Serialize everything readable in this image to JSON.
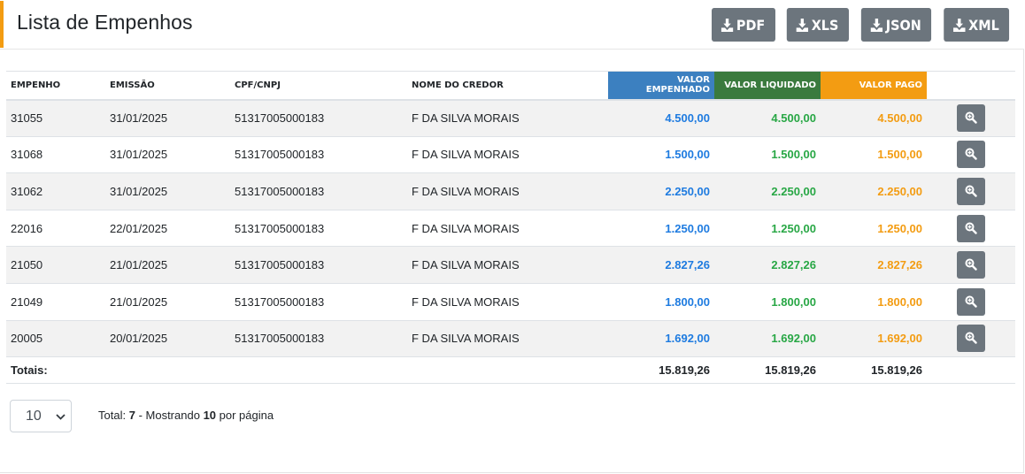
{
  "header": {
    "title": "Lista de Empenhos",
    "buttons": [
      "PDF",
      "XLS",
      "JSON",
      "XML"
    ]
  },
  "table": {
    "columns": {
      "empenho": "EMPENHO",
      "emissao": "EMISSÃO",
      "cpf": "CPF/CNPJ",
      "credor": "NOME DO CREDOR",
      "valor_empenhado": "VALOR EMPENHADO",
      "valor_liquidado": "VALOR LIQUIDADO",
      "valor_pago": "VALOR PAGO"
    },
    "rows": [
      {
        "empenho": "31055",
        "emissao": "31/01/2025",
        "cpf": "51317005000183",
        "credor": "F DA SILVA MORAIS",
        "empenhado": "4.500,00",
        "liquidado": "4.500,00",
        "pago": "4.500,00"
      },
      {
        "empenho": "31068",
        "emissao": "31/01/2025",
        "cpf": "51317005000183",
        "credor": "F DA SILVA MORAIS",
        "empenhado": "1.500,00",
        "liquidado": "1.500,00",
        "pago": "1.500,00"
      },
      {
        "empenho": "31062",
        "emissao": "31/01/2025",
        "cpf": "51317005000183",
        "credor": "F DA SILVA MORAIS",
        "empenhado": "2.250,00",
        "liquidado": "2.250,00",
        "pago": "2.250,00"
      },
      {
        "empenho": "22016",
        "emissao": "22/01/2025",
        "cpf": "51317005000183",
        "credor": "F DA SILVA MORAIS",
        "empenhado": "1.250,00",
        "liquidado": "1.250,00",
        "pago": "1.250,00"
      },
      {
        "empenho": "21050",
        "emissao": "21/01/2025",
        "cpf": "51317005000183",
        "credor": "F DA SILVA MORAIS",
        "empenhado": "2.827,26",
        "liquidado": "2.827,26",
        "pago": "2.827,26"
      },
      {
        "empenho": "21049",
        "emissao": "21/01/2025",
        "cpf": "51317005000183",
        "credor": "F DA SILVA MORAIS",
        "empenhado": "1.800,00",
        "liquidado": "1.800,00",
        "pago": "1.800,00"
      },
      {
        "empenho": "20005",
        "emissao": "20/01/2025",
        "cpf": "51317005000183",
        "credor": "F DA SILVA MORAIS",
        "empenhado": "1.692,00",
        "liquidado": "1.692,00",
        "pago": "1.692,00"
      }
    ],
    "totals": {
      "label": "Totais:",
      "empenhado": "15.819,26",
      "liquidado": "15.819,26",
      "pago": "15.819,26"
    }
  },
  "pagination": {
    "page_size_value": "10",
    "total_label": "Total:",
    "total_count": "7",
    "showing_label": "- Mostrando",
    "per_page_count": "10",
    "per_page_label": "por página"
  },
  "colors": {
    "accent": "#f39c12",
    "empenhado": "#3c80c0",
    "liquidado": "#3a7a3e",
    "pago": "#f39c12",
    "button": "#6c757d"
  },
  "icons": [
    "download-icon",
    "zoom-in-icon",
    "chevron-down-icon"
  ]
}
